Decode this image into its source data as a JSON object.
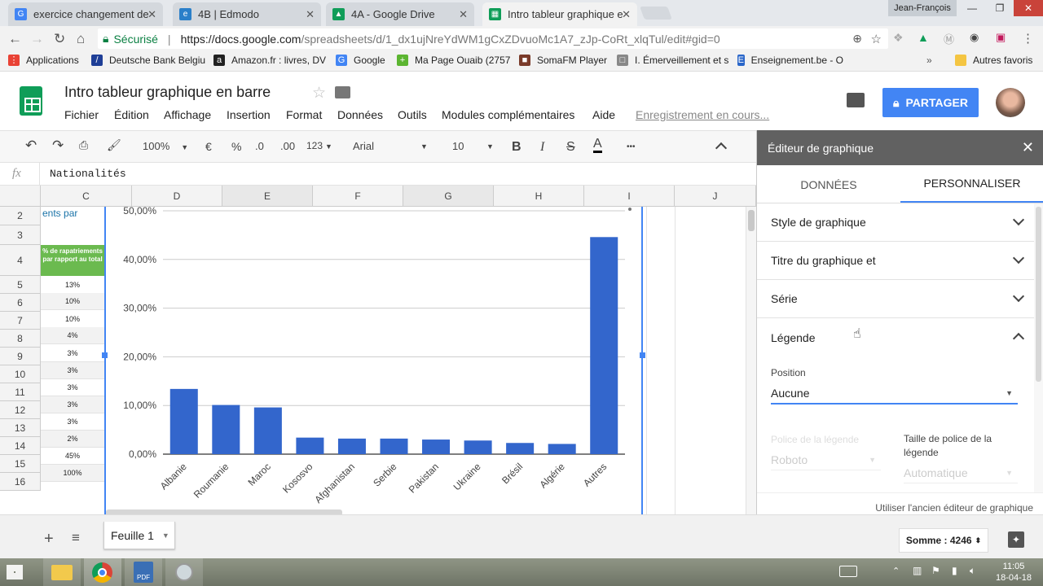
{
  "browser": {
    "tabs": [
      {
        "label": "exercice changement de",
        "color": "#4285f4",
        "glyph": "G"
      },
      {
        "label": "4B | Edmodo",
        "color": "#2a7fc9",
        "glyph": "e"
      },
      {
        "label": "4A - Google Drive",
        "color": "#0f9d58",
        "glyph": "▲"
      },
      {
        "label": "Intro tableur graphique e",
        "color": "#0f9d58",
        "glyph": "▦"
      }
    ],
    "user": "Jean-François",
    "secure_label": "Sécurisé",
    "url_host": "https://docs.google.com",
    "url_path": "/spreadsheets/d/1_dx1ujNreYdWM1gCxZDvuoMc1A7_zJp-CoRt_xlqTul/edit#gid=0",
    "bookmarks": [
      {
        "label": "Applications",
        "color": "#e94235",
        "glyph": "⋮"
      },
      {
        "label": "Deutsche Bank Belgiu",
        "color": "#1f3f97",
        "glyph": "/"
      },
      {
        "label": "Amazon.fr : livres, DV",
        "color": "#222",
        "glyph": "a"
      },
      {
        "label": "Google",
        "color": "#4285f4",
        "glyph": "G"
      },
      {
        "label": "Ma Page Ouaib (2757",
        "color": "#5cb531",
        "glyph": "+"
      },
      {
        "label": "SomaFM Player",
        "color": "#7a3b2a",
        "glyph": "■"
      },
      {
        "label": "I. Émerveillement et s",
        "color": "#888",
        "glyph": "□"
      },
      {
        "label": "Enseignement.be - O",
        "color": "#2a66c9",
        "glyph": "E"
      }
    ],
    "other_bookmarks": "Autres favoris"
  },
  "doc": {
    "title": "Intro tableur graphique en barre",
    "menus": [
      "Fichier",
      "Édition",
      "Affichage",
      "Insertion",
      "Format",
      "Données",
      "Outils",
      "Modules complémentaires",
      "Aide"
    ],
    "saving": "Enregistrement en cours...",
    "share": "PARTAGER"
  },
  "toolbar": {
    "zoom": "100%",
    "currency": "€",
    "percent": "%",
    "dec_less": ".0",
    "dec_more": ".00",
    "format": "123",
    "font": "Arial",
    "size": "10",
    "bold": "B",
    "italic": "I",
    "strike": "S",
    "textcolor": "A",
    "more": "•••"
  },
  "formula": {
    "fx": "fx",
    "value": "Nationalités"
  },
  "grid": {
    "columns": [
      "C",
      "D",
      "E",
      "F",
      "G",
      "H",
      "I",
      "J"
    ],
    "rows": [
      "2",
      "3",
      "4",
      "5",
      "6",
      "7",
      "8",
      "9",
      "10",
      "11",
      "12",
      "13",
      "14",
      "15",
      "16"
    ],
    "c2_text": "ents par",
    "header_cell": "% de rapatriements par rapport au total",
    "c_values": [
      "13%",
      "10%",
      "10%",
      "4%",
      "3%",
      "3%",
      "3%",
      "3%",
      "3%",
      "2%",
      "45%",
      "100%"
    ]
  },
  "chart_data": {
    "type": "bar",
    "categories": [
      "Albanie",
      "Roumanie",
      "Maroc",
      "Kososvo",
      "Afghanistan",
      "Serbie",
      "Pakistan",
      "Ukraine",
      "Brésil",
      "Algérie",
      "Autres"
    ],
    "values": [
      13.4,
      10.1,
      9.6,
      3.4,
      3.2,
      3.2,
      3.0,
      2.8,
      2.3,
      2.1,
      44.6
    ],
    "yticks": [
      "0,00%",
      "10,00%",
      "20,00%",
      "30,00%",
      "40,00%",
      "50,00%"
    ],
    "ylim": [
      0,
      50
    ],
    "color": "#3366cc",
    "grid": true,
    "legend": "none"
  },
  "sheetbar": {
    "sheet": "Feuille 1",
    "sum": "Somme : 4246"
  },
  "panel": {
    "title": "Éditeur de graphique",
    "tabs": [
      "DONNÉES",
      "PERSONNALISER"
    ],
    "sections": [
      "Style de graphique",
      "Titre du graphique et",
      "Série",
      "Légende"
    ],
    "position_label": "Position",
    "position_value": "Aucune",
    "font_label": "Police de la légende",
    "font_value": "Roboto",
    "size_label": "Taille de police de la légende",
    "size_value": "Automatique",
    "old_editor": "Utiliser l'ancien éditeur de graphique"
  },
  "taskbar": {
    "time": "11:05",
    "date": "18-04-18"
  }
}
